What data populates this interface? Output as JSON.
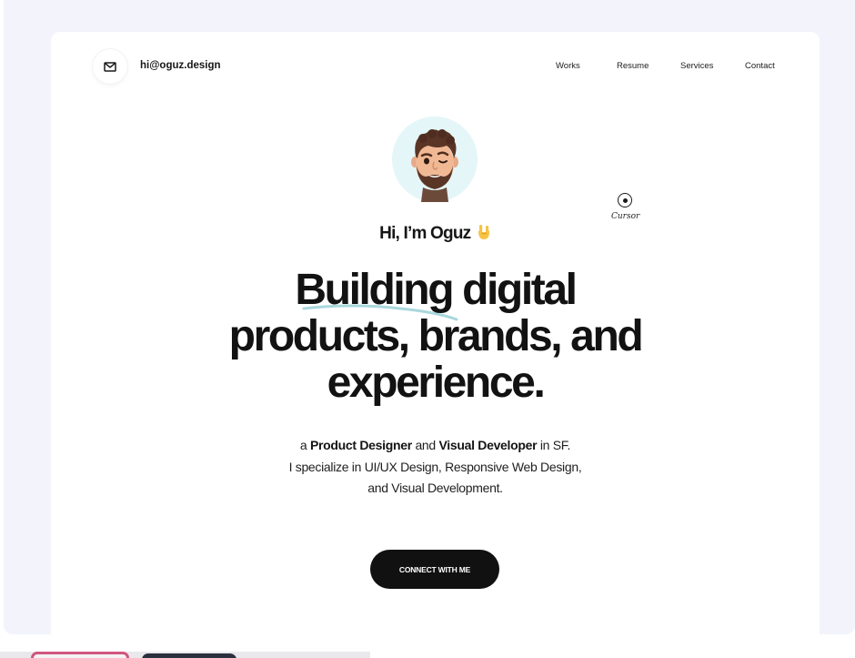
{
  "header": {
    "email": "hi@oguz.design",
    "mail_icon": "mail-icon",
    "nav": [
      "Works",
      "Resume",
      "Services",
      "Contact"
    ]
  },
  "cursor_widget": {
    "label": "Cursor"
  },
  "hero": {
    "avatar_icon": "memoji-avatar-icon",
    "greeting": "Hi, I’m Oguz",
    "greeting_emoji_icon": "rock-on-hand-icon",
    "headline": [
      "Building digital",
      "products, brands, and",
      "experience."
    ],
    "bio": {
      "prefix": "a ",
      "role1": "Product Designer",
      "mid": " and ",
      "role2": "Visual Developer",
      "suffix": " in SF.",
      "line2": "I specialize in UI/UX Design, Responsive Web Design,",
      "line3": "and Visual Development."
    },
    "cta_label": "CONNECT WITH ME"
  },
  "colors": {
    "page_bg": "#f3f4fb",
    "card_bg": "#ffffff",
    "avatar_bg": "#e4f6f8",
    "underline_accent": "#9fd3d8",
    "cta_bg": "#111112",
    "text": "#121212"
  }
}
